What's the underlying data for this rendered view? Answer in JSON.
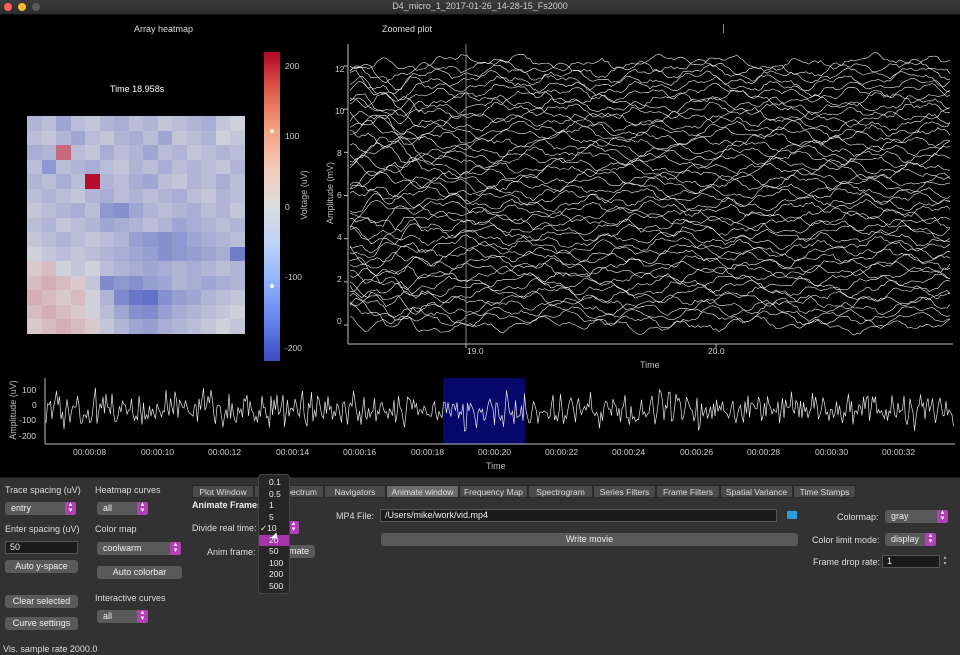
{
  "window": {
    "title": "D4_micro_1_2017-01-26_14-28-15_Fs2000"
  },
  "titles": {
    "heatmap": "Array heatmap",
    "zoomed": "Zoomed plot"
  },
  "heatmap": {
    "time_label": "Time 18.958s",
    "colorbar_label": "Voltage (uV)",
    "colorbar_ticks": [
      "200",
      "100",
      "0",
      "-100",
      "-200"
    ],
    "grid": [
      [
        -40,
        -30,
        -60,
        -30,
        -20,
        -40,
        -50,
        -30,
        -40,
        -20,
        -30,
        -40,
        -50,
        -20,
        -10
      ],
      [
        -30,
        -20,
        -40,
        -60,
        -30,
        -20,
        -40,
        -50,
        -30,
        -60,
        -20,
        -30,
        -40,
        -10,
        -20
      ],
      [
        -50,
        -40,
        90,
        -30,
        -20,
        -50,
        -30,
        -40,
        -60,
        -30,
        -40,
        -20,
        -30,
        -40,
        -30
      ],
      [
        -30,
        -80,
        -30,
        -40,
        -50,
        -30,
        -20,
        -40,
        -30,
        -50,
        -30,
        -40,
        -30,
        -20,
        -40
      ],
      [
        -40,
        -30,
        -50,
        -30,
        190,
        -40,
        -30,
        -50,
        -60,
        -30,
        -20,
        -40,
        -30,
        -50,
        -30
      ],
      [
        -30,
        -40,
        -30,
        -20,
        -40,
        -50,
        -30,
        -40,
        -30,
        -40,
        -50,
        -30,
        -20,
        -40,
        -30
      ],
      [
        -20,
        -30,
        -40,
        -50,
        -30,
        -80,
        -90,
        -60,
        -40,
        -30,
        -40,
        -50,
        -30,
        -40,
        -20
      ],
      [
        -30,
        -40,
        -20,
        -30,
        -40,
        -60,
        -50,
        -40,
        -30,
        -40,
        -60,
        -50,
        -40,
        -30,
        -40
      ],
      [
        -20,
        -30,
        -40,
        -30,
        -20,
        -30,
        -40,
        -70,
        -80,
        -90,
        -80,
        -60,
        -50,
        -40,
        -30
      ],
      [
        -10,
        -20,
        -30,
        -20,
        -30,
        -40,
        -50,
        -60,
        -70,
        -90,
        -80,
        -70,
        -60,
        -50,
        -120
      ],
      [
        10,
        20,
        -10,
        -20,
        -10,
        -30,
        -40,
        -50,
        -60,
        -50,
        -40,
        -50,
        -40,
        -30,
        -40
      ],
      [
        20,
        30,
        20,
        10,
        -20,
        -100,
        -80,
        -90,
        -70,
        -60,
        -40,
        -50,
        -60,
        -50,
        -40
      ],
      [
        30,
        20,
        10,
        20,
        -10,
        -40,
        -100,
        -130,
        -140,
        -90,
        -70,
        -60,
        -40,
        -30,
        -20
      ],
      [
        20,
        30,
        20,
        10,
        -10,
        -30,
        -60,
        -90,
        -100,
        -70,
        -50,
        -40,
        -30,
        -20,
        -10
      ],
      [
        10,
        20,
        30,
        20,
        10,
        -20,
        -40,
        -60,
        -70,
        -50,
        -40,
        -30,
        -20,
        -10,
        -20
      ]
    ]
  },
  "zoomed": {
    "ylabel": "Amplitude (mV)",
    "xlabel": "Time",
    "yticks": [
      "12",
      "10",
      "8",
      "6",
      "4",
      "2",
      "0"
    ],
    "xticks": [
      "19.0",
      "20.0"
    ]
  },
  "navigator": {
    "ylabel": "Amplitude (uV)",
    "xlabel": "Time",
    "yticks": [
      "100",
      "0",
      "-100",
      "-200"
    ],
    "xticks": [
      "00:00:08",
      "00:00:10",
      "00:00:12",
      "00:00:14",
      "00:00:16",
      "00:00:18",
      "00:00:20",
      "00:00:22",
      "00:00:24",
      "00:00:26",
      "00:00:28",
      "00:00:30",
      "00:00:32"
    ]
  },
  "controls": {
    "trace_spacing_label": "Trace spacing (uV)",
    "trace_spacing_value": "entry",
    "heatmap_curves_label": "Heatmap curves",
    "heatmap_curves_value": "all",
    "enter_spacing_label": "Enter spacing (uV)",
    "enter_spacing_value": "50",
    "color_map_label": "Color map",
    "color_map_value": "coolwarm",
    "auto_yspace": "Auto y-space",
    "auto_colorbar": "Auto colorbar",
    "clear_selected": "Clear selected",
    "interactive_curves_label": "Interactive curves",
    "interactive_curves_value": "all",
    "curve_settings": "Curve settings",
    "status": "Vis. sample rate  2000.0"
  },
  "tabs": [
    "Plot Window",
    "Spectrum",
    "Navigators",
    "Animate window",
    "Frequency Map",
    "Spectrogram",
    "Series Filters",
    "Frame Filters",
    "Spatial Variance",
    "Time Stamps"
  ],
  "animate": {
    "section_title": "Animate Frames",
    "divide_label": "Divide real time:",
    "anim_frame_label": "Anim frame:",
    "animate_button": "nimate",
    "mp4_label": "MP4 File:",
    "mp4_value": "/Users/mike/work/vid.mp4",
    "write_movie": "Write movie",
    "colormap_label": "Colormap:",
    "colormap_value": "gray",
    "color_limit_label": "Color limit mode:",
    "color_limit_value": "display",
    "frame_drop_label": "Frame drop rate:",
    "frame_drop_value": "1"
  },
  "dropdown": {
    "options": [
      "0.1",
      "0.5",
      "1",
      "5",
      "10",
      "20",
      "50",
      "100",
      "200",
      "500"
    ],
    "checked": "10",
    "highlighted": "20"
  }
}
